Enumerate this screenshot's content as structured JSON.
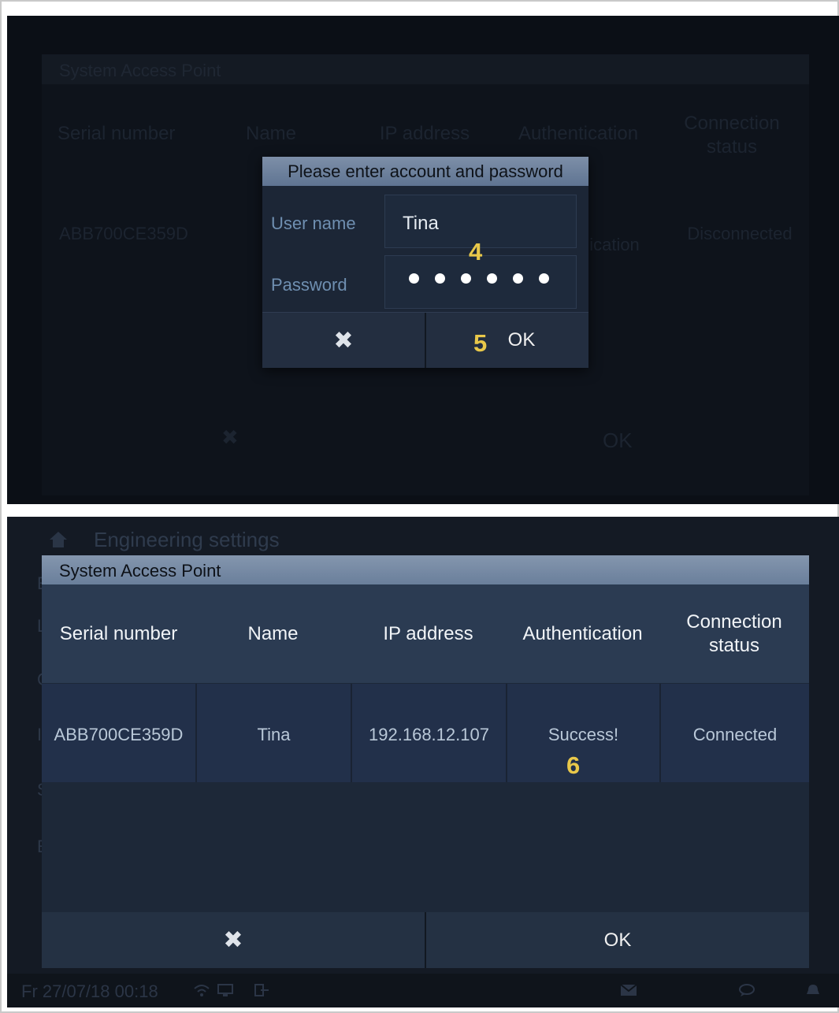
{
  "panel1": {
    "background": {
      "window_title": "System Access Point",
      "columns": [
        "Serial number",
        "Name",
        "IP address",
        "Authentication",
        "Connection status"
      ],
      "row_partial": {
        "serial": "ABB700CE359D",
        "auth_fragment": "ication",
        "status": "Disconnected"
      },
      "ok_label": "OK"
    },
    "dialog": {
      "title": "Please enter account and password",
      "username_label": "User name",
      "username_value": "Tina",
      "password_label": "Password",
      "password_length": 6,
      "ok_label": "OK"
    },
    "markers": {
      "fields": "4",
      "ok": "5"
    }
  },
  "panel2": {
    "header": "Engineering settings",
    "window_title": "System Access Point",
    "columns": [
      "Serial number",
      "Name",
      "IP address",
      "Authentication",
      "Connection\nstatus"
    ],
    "rows": [
      {
        "serial": "ABB700CE359D",
        "name": "Tina",
        "ip": "192.168.12.107",
        "auth": "Success!",
        "status": "Connected"
      }
    ],
    "ok_label": "OK",
    "marker": "6",
    "status_time": "Fr 27/07/18  00:18"
  },
  "colors": {
    "marker": "#e9c84a",
    "header_bg": "#2b3b52",
    "dialog_title": "#6a7f9b"
  }
}
